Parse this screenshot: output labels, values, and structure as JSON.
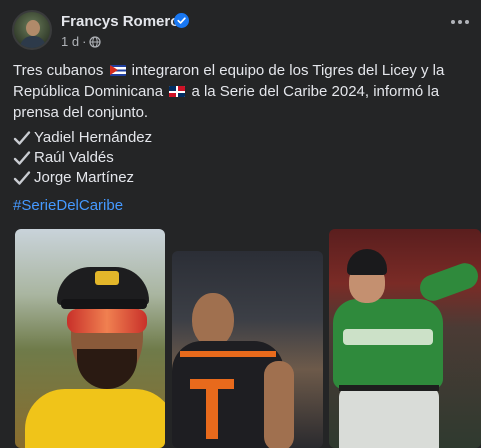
{
  "post": {
    "author": "Francys Romero",
    "time": "1 d",
    "separator": "·",
    "text": {
      "part1": "Tres cubanos",
      "part2": "integraron el equipo de los Tigres del Licey y la República Dominicana",
      "part3": "a la Serie del Caribe 2024, informó la prensa del conjunto."
    },
    "players": [
      "Yadiel Hernández",
      "Raúl Valdés",
      "Jorge Martínez"
    ],
    "hashtag": "#SerieDelCaribe"
  },
  "icons": {
    "verified": "verified-badge-icon",
    "audience": "globe-icon",
    "more": "more-options-icon",
    "check": "check-mark-icon",
    "flags": [
      "cuba-flag-icon",
      "dominican-republic-flag-icon"
    ]
  },
  "colors": {
    "background": "#242526",
    "text": "#e4e6eb",
    "secondary": "#b0b3b8",
    "link": "#4599ff",
    "verified": "#1877f2"
  }
}
